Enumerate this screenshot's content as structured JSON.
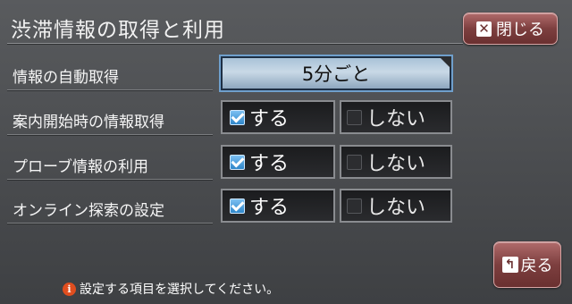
{
  "header": {
    "title": "渋滞情報の取得と利用",
    "close_label": "閉じる"
  },
  "rows": [
    {
      "label": "情報の自動取得",
      "value": "5分ごと"
    },
    {
      "label": "案内開始時の情報取得",
      "yes": "する",
      "no": "しない",
      "selected": "yes"
    },
    {
      "label": "プローブ情報の利用",
      "yes": "する",
      "no": "しない",
      "selected": "yes"
    },
    {
      "label": "オンライン探索の設定",
      "yes": "する",
      "no": "しない",
      "selected": "yes"
    }
  ],
  "footer": {
    "help_text": "設定する項目を選択してください。",
    "back_label": "戻る"
  },
  "icons": {
    "close": "close-x-icon",
    "back": "back-arrow-icon",
    "info": "info-icon",
    "check": "checkbox-icon"
  },
  "colors": {
    "accent_button": "#7d3f3f",
    "select_highlight": "#6f9fcc",
    "checkbox_on": "#2f86c9"
  }
}
